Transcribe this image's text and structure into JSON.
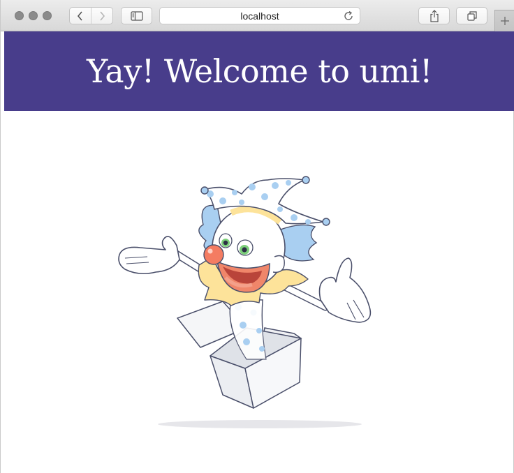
{
  "browser": {
    "address_url": "localhost",
    "icons": {
      "back": "chevron-left-icon",
      "forward": "chevron-right-icon",
      "sidebar": "sidebar-icon",
      "reload": "reload-icon",
      "share": "share-icon",
      "tabs": "tabs-overview-icon",
      "new_tab": "plus-icon"
    }
  },
  "page": {
    "heading": "Yay! Welcome to umi!",
    "banner_color": "#483d8b",
    "illustration": "jack-in-the-box clown"
  }
}
